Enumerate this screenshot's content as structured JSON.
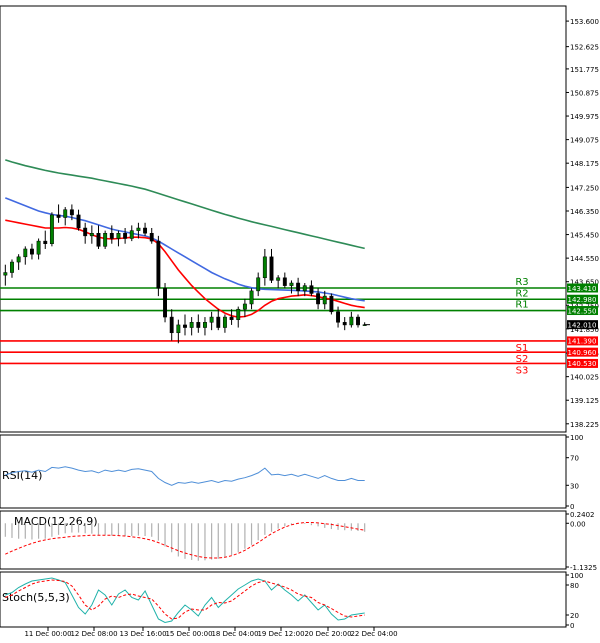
{
  "chart_data": [
    {
      "type": "candlestick",
      "name": "price",
      "title": "",
      "x_tick_labels": [
        "11 Dec 00:00",
        "12 Dec 08:00",
        "13 Dec 16:00",
        "15 Dec 00:00",
        "18 Dec 04:00",
        "19 Dec 12:00",
        "20 Dec 20:00",
        "22 Dec 04:00"
      ],
      "x_tick_labels_visible": [
        "11 Dec 00:00",
        "12 Dec 08:00",
        "13 Dec 16:00",
        "15 Dec 00:00",
        "18 Dec 04:00",
        "19 Dec 12:00",
        "20 Dec 20:00",
        "22 Dec 04:00"
      ],
      "y_ticks": [
        153.6,
        152.625,
        151.775,
        150.875,
        149.975,
        149.075,
        148.175,
        147.25,
        146.35,
        145.45,
        144.55,
        143.65,
        142.75,
        141.85,
        140.925,
        140.025,
        139.125,
        138.225
      ],
      "y_tick_labels": [
        "153.600",
        "152.625",
        "151.775",
        "150.875",
        "149.975",
        "149.075",
        "148.175",
        "147.250",
        "146.350",
        "145.450",
        "144.550",
        "143.650",
        "142.750",
        "141.850",
        "140.925",
        "140.025",
        "139.125",
        "138.225"
      ],
      "ylim": [
        137.95,
        154.1
      ],
      "candles": [
        [
          143.9,
          144.3,
          143.5,
          144.0
        ],
        [
          144.0,
          144.5,
          143.8,
          144.4
        ],
        [
          144.4,
          144.7,
          144.1,
          144.6
        ],
        [
          144.6,
          145.0,
          144.3,
          144.9
        ],
        [
          144.9,
          145.1,
          144.5,
          144.7
        ],
        [
          144.7,
          145.3,
          144.5,
          145.2
        ],
        [
          145.2,
          145.6,
          144.9,
          145.1
        ],
        [
          145.1,
          146.3,
          145.0,
          146.2
        ],
        [
          146.2,
          146.6,
          145.9,
          146.1
        ],
        [
          146.1,
          146.5,
          145.8,
          146.4
        ],
        [
          146.4,
          146.6,
          146.0,
          146.2
        ],
        [
          146.2,
          146.4,
          145.6,
          145.7
        ],
        [
          145.7,
          145.9,
          145.1,
          145.4
        ],
        [
          145.4,
          145.8,
          145.1,
          145.5
        ],
        [
          145.5,
          145.8,
          144.9,
          145.0
        ],
        [
          145.0,
          145.6,
          144.9,
          145.5
        ],
        [
          145.5,
          145.8,
          145.1,
          145.3
        ],
        [
          145.3,
          145.6,
          145.0,
          145.5
        ],
        [
          145.5,
          145.7,
          145.1,
          145.3
        ],
        [
          145.3,
          145.8,
          145.2,
          145.6
        ],
        [
          145.6,
          145.9,
          145.3,
          145.7
        ],
        [
          145.7,
          145.9,
          145.4,
          145.5
        ],
        [
          145.5,
          145.7,
          145.1,
          145.2
        ],
        [
          145.2,
          145.4,
          143.1,
          143.4
        ],
        [
          143.4,
          143.6,
          142.1,
          142.3
        ],
        [
          142.3,
          142.6,
          141.4,
          141.7
        ],
        [
          141.7,
          142.2,
          141.3,
          142.0
        ],
        [
          142.0,
          142.4,
          141.6,
          141.9
        ],
        [
          141.9,
          142.3,
          141.6,
          142.1
        ],
        [
          142.1,
          142.4,
          141.7,
          141.9
        ],
        [
          141.9,
          142.3,
          141.6,
          142.1
        ],
        [
          142.1,
          142.5,
          141.8,
          142.3
        ],
        [
          142.3,
          142.6,
          141.8,
          141.9
        ],
        [
          141.9,
          142.4,
          141.7,
          142.3
        ],
        [
          142.3,
          142.6,
          142.0,
          142.2
        ],
        [
          142.2,
          142.7,
          141.9,
          142.6
        ],
        [
          142.6,
          143.0,
          142.3,
          142.8
        ],
        [
          142.8,
          143.4,
          142.6,
          143.3
        ],
        [
          143.3,
          144.0,
          143.1,
          143.8
        ],
        [
          143.8,
          144.9,
          143.5,
          144.6
        ],
        [
          144.6,
          144.9,
          143.6,
          143.7
        ],
        [
          143.7,
          143.9,
          143.4,
          143.8
        ],
        [
          143.8,
          144.0,
          143.4,
          143.5
        ],
        [
          143.5,
          143.7,
          143.2,
          143.6
        ],
        [
          143.6,
          143.8,
          143.1,
          143.3
        ],
        [
          143.3,
          143.6,
          143.1,
          143.5
        ],
        [
          143.5,
          143.7,
          143.1,
          143.2
        ],
        [
          143.2,
          143.4,
          142.6,
          142.8
        ],
        [
          142.8,
          143.3,
          142.6,
          143.1
        ],
        [
          143.1,
          143.2,
          142.4,
          142.5
        ],
        [
          142.5,
          142.7,
          141.9,
          142.1
        ],
        [
          142.1,
          142.3,
          141.8,
          142.0
        ],
        [
          142.0,
          142.5,
          141.9,
          142.3
        ],
        [
          142.3,
          142.4,
          141.9,
          142.0
        ],
        [
          142.0,
          142.1,
          142.0,
          142.01
        ]
      ],
      "ma_fast": [
        146.0,
        145.95,
        145.9,
        145.85,
        145.8,
        145.75,
        145.7,
        145.7,
        145.7,
        145.72,
        145.7,
        145.65,
        145.55,
        145.45,
        145.35,
        145.3,
        145.28,
        145.3,
        145.32,
        145.35,
        145.35,
        145.33,
        145.28,
        145.1,
        144.8,
        144.45,
        144.1,
        143.8,
        143.5,
        143.25,
        143.0,
        142.8,
        142.6,
        142.45,
        142.35,
        142.3,
        142.32,
        142.4,
        142.55,
        142.75,
        142.9,
        143.0,
        143.05,
        143.1,
        143.12,
        143.15,
        143.12,
        143.08,
        143.02,
        142.98,
        142.9,
        142.82,
        142.75,
        142.7,
        142.66
      ],
      "ma_mid": [
        146.85,
        146.75,
        146.65,
        146.55,
        146.45,
        146.35,
        146.28,
        146.22,
        146.18,
        146.15,
        146.1,
        146.04,
        145.98,
        145.9,
        145.82,
        145.74,
        145.66,
        145.6,
        145.55,
        145.5,
        145.45,
        145.4,
        145.32,
        145.2,
        145.05,
        144.9,
        144.75,
        144.6,
        144.45,
        144.3,
        144.15,
        144.0,
        143.88,
        143.76,
        143.66,
        143.56,
        143.48,
        143.42,
        143.38,
        143.36,
        143.35,
        143.34,
        143.33,
        143.32,
        143.31,
        143.3,
        143.28,
        143.26,
        143.22,
        143.18,
        143.12,
        143.06,
        143.0,
        142.96,
        142.92
      ],
      "ma_slow": [
        148.3,
        148.22,
        148.15,
        148.08,
        148.02,
        147.96,
        147.9,
        147.85,
        147.8,
        147.76,
        147.72,
        147.68,
        147.64,
        147.6,
        147.55,
        147.5,
        147.45,
        147.4,
        147.35,
        147.3,
        147.24,
        147.18,
        147.1,
        147.02,
        146.94,
        146.86,
        146.78,
        146.7,
        146.62,
        146.54,
        146.46,
        146.38,
        146.3,
        146.22,
        146.15,
        146.08,
        146.01,
        145.94,
        145.88,
        145.82,
        145.76,
        145.7,
        145.64,
        145.58,
        145.52,
        145.46,
        145.4,
        145.34,
        145.28,
        145.22,
        145.16,
        145.1,
        145.04,
        144.98,
        144.92
      ],
      "pivot_levels": [
        {
          "label": "R3",
          "value": 143.41,
          "value_label": "143.410",
          "color": "#008000"
        },
        {
          "label": "R2",
          "value": 142.98,
          "value_label": "142.980",
          "color": "#008000"
        },
        {
          "label": "R1",
          "value": 142.55,
          "value_label": "142.550",
          "color": "#008000"
        },
        {
          "label": "S1",
          "value": 141.39,
          "value_label": "141.390",
          "color": "#ff0000"
        },
        {
          "label": "S2",
          "value": 140.96,
          "value_label": "140.960",
          "color": "#ff0000"
        },
        {
          "label": "S3",
          "value": 140.53,
          "value_label": "140.530",
          "color": "#ff0000"
        }
      ],
      "current_price": {
        "value": 142.01,
        "label": "142.010",
        "color": "#000000"
      },
      "colors": {
        "ma_fast": "#ff0000",
        "ma_mid": "#4169e1",
        "ma_slow": "#2e8b57",
        "candle": "#008000"
      }
    },
    {
      "type": "line",
      "name": "RSI(14)",
      "title": "RSI(14)",
      "y_tick_labels": [
        "100",
        "70",
        "30",
        "0"
      ],
      "ylim": [
        0,
        100
      ],
      "values": [
        45,
        48,
        50,
        51,
        49,
        52,
        50,
        56,
        55,
        57,
        55,
        52,
        50,
        51,
        48,
        52,
        50,
        52,
        50,
        53,
        54,
        52,
        50,
        40,
        34,
        30,
        34,
        33,
        35,
        33,
        35,
        37,
        34,
        37,
        36,
        39,
        41,
        44,
        48,
        55,
        45,
        46,
        44,
        46,
        43,
        46,
        43,
        40,
        44,
        40,
        37,
        37,
        40,
        37,
        37
      ],
      "color": "#4f8fd8"
    },
    {
      "type": "bar+line",
      "name": "MACD(12,26,9)",
      "title": "MACD(12,26,9)",
      "y_tick_labels": [
        "0.2402",
        "0.00",
        "-1.1325"
      ],
      "ylim": [
        -1.1325,
        0.2402
      ],
      "histogram": [
        -0.35,
        -0.38,
        -0.4,
        -0.4,
        -0.42,
        -0.4,
        -0.4,
        -0.35,
        -0.3,
        -0.26,
        -0.24,
        -0.24,
        -0.26,
        -0.27,
        -0.3,
        -0.3,
        -0.32,
        -0.32,
        -0.33,
        -0.33,
        -0.32,
        -0.33,
        -0.35,
        -0.45,
        -0.6,
        -0.75,
        -0.86,
        -0.92,
        -0.95,
        -0.97,
        -0.96,
        -0.94,
        -0.92,
        -0.88,
        -0.82,
        -0.75,
        -0.66,
        -0.56,
        -0.44,
        -0.3,
        -0.22,
        -0.14,
        -0.08,
        -0.04,
        -0.01,
        -0.02,
        -0.05,
        -0.08,
        -0.12,
        -0.15,
        -0.17,
        -0.18,
        -0.19,
        -0.2,
        -0.22
      ],
      "signal": [
        -0.8,
        -0.72,
        -0.65,
        -0.58,
        -0.52,
        -0.47,
        -0.43,
        -0.4,
        -0.38,
        -0.36,
        -0.34,
        -0.33,
        -0.32,
        -0.31,
        -0.31,
        -0.31,
        -0.31,
        -0.32,
        -0.33,
        -0.35,
        -0.37,
        -0.4,
        -0.44,
        -0.5,
        -0.57,
        -0.64,
        -0.71,
        -0.77,
        -0.82,
        -0.86,
        -0.89,
        -0.9,
        -0.9,
        -0.88,
        -0.84,
        -0.78,
        -0.7,
        -0.6,
        -0.5,
        -0.38,
        -0.27,
        -0.18,
        -0.1,
        -0.04,
        0.0,
        0.02,
        0.02,
        0.01,
        -0.01,
        -0.03,
        -0.06,
        -0.09,
        -0.12,
        -0.15,
        -0.18
      ],
      "colors": {
        "histogram": "#b0b0b0",
        "signal": "#ff0000"
      }
    },
    {
      "type": "line",
      "name": "Stoch(5,5,3)",
      "title": "Stoch(5,5,3)",
      "y_tick_labels": [
        "100",
        "80",
        "20",
        "0"
      ],
      "ylim": [
        0,
        100
      ],
      "main": [
        60,
        65,
        75,
        82,
        88,
        90,
        92,
        94,
        90,
        85,
        60,
        35,
        22,
        40,
        70,
        60,
        40,
        62,
        70,
        55,
        50,
        68,
        40,
        12,
        5,
        8,
        25,
        40,
        30,
        18,
        40,
        55,
        35,
        48,
        60,
        72,
        80,
        88,
        92,
        88,
        70,
        82,
        70,
        60,
        48,
        60,
        45,
        30,
        40,
        22,
        10,
        12,
        20,
        22,
        24
      ],
      "signal": [
        55,
        60,
        68,
        75,
        82,
        86,
        88,
        90,
        89,
        87,
        78,
        60,
        40,
        30,
        38,
        52,
        58,
        55,
        60,
        62,
        58,
        55,
        52,
        38,
        22,
        12,
        14,
        26,
        32,
        30,
        30,
        40,
        45,
        44,
        48,
        58,
        68,
        78,
        85,
        88,
        84,
        80,
        76,
        70,
        62,
        58,
        55,
        45,
        40,
        33,
        25,
        18,
        16,
        18,
        20
      ],
      "colors": {
        "main": "#20b2aa",
        "signal": "#ff0000"
      }
    }
  ]
}
